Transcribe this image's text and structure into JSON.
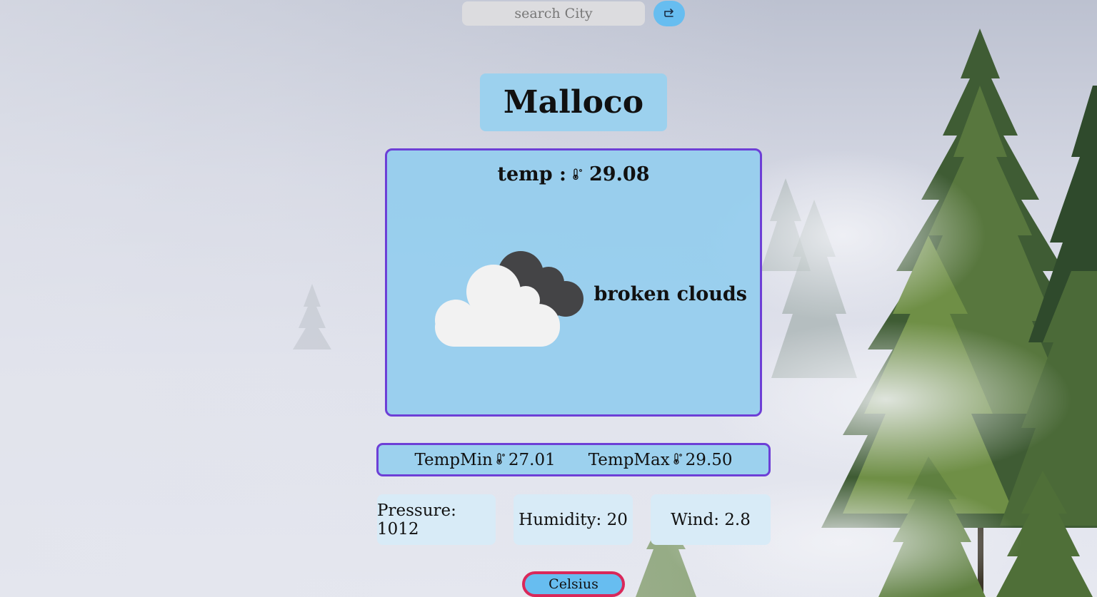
{
  "search": {
    "placeholder": "search City",
    "button_icon": "refresh-icon"
  },
  "city": "Malloco",
  "current": {
    "temp_label": "temp :",
    "temp_icon": "thermometer-icon",
    "temp_value": "29.08",
    "weather_icon": "broken-clouds-icon",
    "description": "broken clouds"
  },
  "range": {
    "min_label": "TempMin",
    "min_value": "27.01",
    "max_label": "TempMax",
    "max_value": "29.50"
  },
  "stats": {
    "pressure": "Pressure: 1012",
    "humidity": "Humidity: 20",
    "wind": "Wind: 2.8"
  },
  "unit_toggle": "Celsius",
  "colors": {
    "accent_blue": "#67bdf0",
    "card_blue": "#9cd1ee",
    "border_purple": "#6d3fd6",
    "toggle_border": "#d9285a"
  }
}
